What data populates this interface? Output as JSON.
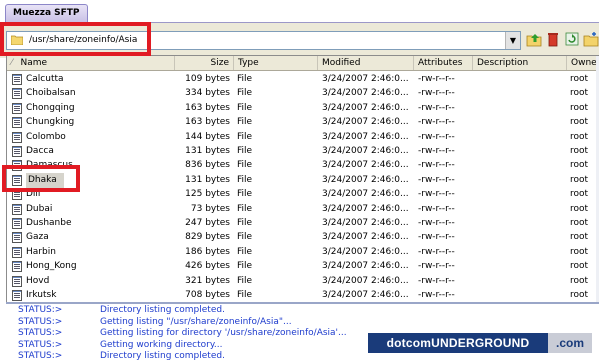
{
  "app": {
    "tab_label": "Muezza SFTP"
  },
  "toolbar": {
    "path": "/usr/share/zoneinfo/Asia"
  },
  "columns": [
    "Name",
    "Size",
    "Type",
    "Modified",
    "Attributes",
    "Description",
    "Owner"
  ],
  "files": [
    {
      "name": "Calcutta",
      "size": "109 bytes",
      "type": "File",
      "modified": "3/24/2007 2:46:0...",
      "attributes": "-rw-r--r--",
      "owner": "root"
    },
    {
      "name": "Choibalsan",
      "size": "334 bytes",
      "type": "File",
      "modified": "3/24/2007 2:46:0...",
      "attributes": "-rw-r--r--",
      "owner": "root"
    },
    {
      "name": "Chongqing",
      "size": "163 bytes",
      "type": "File",
      "modified": "3/24/2007 2:46:0...",
      "attributes": "-rw-r--r--",
      "owner": "root"
    },
    {
      "name": "Chungking",
      "size": "163 bytes",
      "type": "File",
      "modified": "3/24/2007 2:46:0...",
      "attributes": "-rw-r--r--",
      "owner": "root"
    },
    {
      "name": "Colombo",
      "size": "144 bytes",
      "type": "File",
      "modified": "3/24/2007 2:46:0...",
      "attributes": "-rw-r--r--",
      "owner": "root"
    },
    {
      "name": "Dacca",
      "size": "131 bytes",
      "type": "File",
      "modified": "3/24/2007 2:46:0...",
      "attributes": "-rw-r--r--",
      "owner": "root"
    },
    {
      "name": "Damascus",
      "size": "836 bytes",
      "type": "File",
      "modified": "3/24/2007 2:46:0...",
      "attributes": "-rw-r--r--",
      "owner": "root"
    },
    {
      "name": "Dhaka",
      "size": "131 bytes",
      "type": "File",
      "modified": "3/24/2007 2:46:0...",
      "attributes": "-rw-r--r--",
      "owner": "root"
    },
    {
      "name": "Dili",
      "size": "125 bytes",
      "type": "File",
      "modified": "3/24/2007 2:46:0...",
      "attributes": "-rw-r--r--",
      "owner": "root"
    },
    {
      "name": "Dubai",
      "size": "73 bytes",
      "type": "File",
      "modified": "3/24/2007 2:46:0...",
      "attributes": "-rw-r--r--",
      "owner": "root"
    },
    {
      "name": "Dushanbe",
      "size": "247 bytes",
      "type": "File",
      "modified": "3/24/2007 2:46:0...",
      "attributes": "-rw-r--r--",
      "owner": "root"
    },
    {
      "name": "Gaza",
      "size": "829 bytes",
      "type": "File",
      "modified": "3/24/2007 2:46:0...",
      "attributes": "-rw-r--r--",
      "owner": "root"
    },
    {
      "name": "Harbin",
      "size": "186 bytes",
      "type": "File",
      "modified": "3/24/2007 2:46:0...",
      "attributes": "-rw-r--r--",
      "owner": "root"
    },
    {
      "name": "Hong_Kong",
      "size": "426 bytes",
      "type": "File",
      "modified": "3/24/2007 2:46:0...",
      "attributes": "-rw-r--r--",
      "owner": "root"
    },
    {
      "name": "Hovd",
      "size": "321 bytes",
      "type": "File",
      "modified": "3/24/2007 2:46:0...",
      "attributes": "-rw-r--r--",
      "owner": "root"
    },
    {
      "name": "Irkutsk",
      "size": "708 bytes",
      "type": "File",
      "modified": "3/24/2007 2:46:0...",
      "attributes": "-rw-r--r--",
      "owner": "root"
    }
  ],
  "status": {
    "prefix": "STATUS:>",
    "messages": [
      "Directory listing completed.",
      "Getting listing \"/usr/share/zoneinfo/Asia\"...",
      "Getting listing for directory '/usr/share/zoneinfo/Asia'...",
      "Getting working directory...",
      "Directory listing completed."
    ]
  },
  "watermark": {
    "main": "dotcomUNDERGROUND",
    "suffix": ".com"
  },
  "colors": {
    "highlight": "#e11b23",
    "status_text": "#1e3ccd",
    "selection": "#d6d4cc"
  }
}
